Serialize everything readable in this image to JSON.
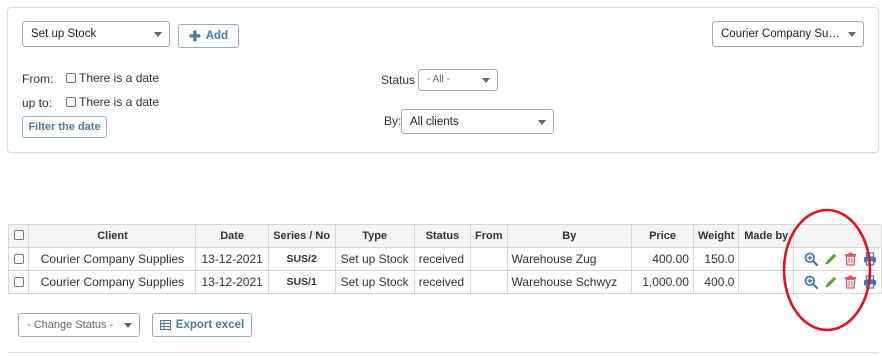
{
  "filters": {
    "type_select": "Set up Stock",
    "add_label": "Add",
    "client_select": "Courier Company Sup…",
    "from_label": "From:",
    "upto_label": "up to:",
    "there_is_a_date": "There is a date",
    "filter_date_label": "Filter the date",
    "status_label": "Status",
    "status_select": "- All -",
    "by_label": "By:",
    "by_select": "All clients"
  },
  "table": {
    "headers": [
      "Client",
      "Date",
      "Series / No",
      "Type",
      "Status",
      "From",
      "By",
      "Price",
      "Weight",
      "Made by"
    ],
    "rows": [
      {
        "client": "Courier Company Supplies",
        "date": "13-12-2021",
        "series": "SUS/2",
        "type": "Set up Stock",
        "status": "received",
        "from": "",
        "by": "Warehouse Zug",
        "price": "400.00",
        "weight": "150.0",
        "made_by": ""
      },
      {
        "client": "Courier Company Supplies",
        "date": "13-12-2021",
        "series": "SUS/1",
        "type": "Set up Stock",
        "status": "received",
        "from": "",
        "by": "Warehouse Schwyz",
        "price": "1,000.00",
        "weight": "400.0",
        "made_by": ""
      }
    ]
  },
  "footer": {
    "change_status_select": "- Change Status -",
    "export_label": "Export excel"
  },
  "colors": {
    "accent": "#4a7aa7",
    "highlight_ring": "#e0141e",
    "edit": "#5aa02c",
    "delete": "#e0585a",
    "view": "#3b78b8"
  }
}
